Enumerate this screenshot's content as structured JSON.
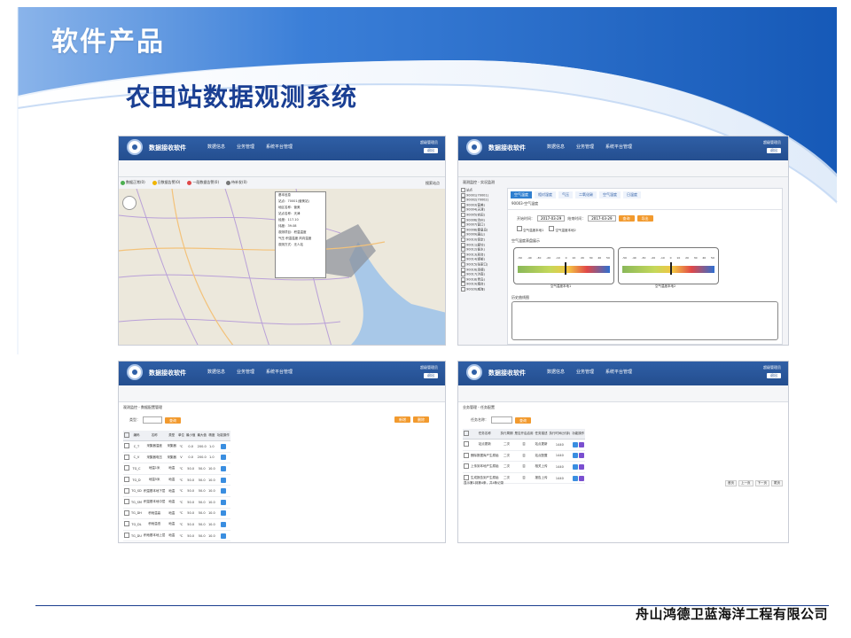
{
  "slide": {
    "title": "软件产品",
    "subtitle": "农田站数据观测系统",
    "company": "舟山鸿德卫蓝海洋工程有限公司",
    "colors": {
      "banner": "#1f5fb8",
      "accent": "#1a3f93",
      "button": "#f29a2e"
    }
  },
  "app": {
    "name": "数据接收软件",
    "nav": [
      "数据信息",
      "业务管理",
      "系统平台管理"
    ],
    "user": "超级管理员",
    "logout": "退出"
  },
  "map_view": {
    "legend": [
      "数据正常(0)",
      "日数据告警(0)",
      "一段数据告警(0)",
      "待补发(0)"
    ],
    "search": "搜索站点",
    "popup": [
      "基本信息",
      "站点：70001(营美站)",
      "地区名称：营美",
      "站点名称：天津",
      "经度：117.10",
      "纬度：39.08",
      "观测项目：积温温度",
      "气压 积温温度 风向温度",
      "观测方式：无人站"
    ]
  },
  "temp_view": {
    "breadcrumb": "观测监控 - 实况监测",
    "tree": [
      "站点",
      "90001(70001)",
      "90002(70002)",
      "90003(营美)",
      "90004(天津)",
      "90005(农田)",
      "90006(沧州)",
      "90007(营口)",
      "90008(秦皇岛)",
      "90009(唐山)",
      "90010(保定)",
      "90011(廊坊)",
      "90012(衡水)",
      "90013(邢台)",
      "90014(邯郸)",
      "90015(张家口)",
      "90016(承德)",
      "90017(济南)",
      "90018(青岛)",
      "90019(烟台)",
      "90020(威海)"
    ],
    "tabs": [
      "空气温度",
      "相对湿度",
      "气压",
      "二氧化碳",
      "空气湿度",
      "日温度"
    ],
    "station_label": "90003-空气温度",
    "start_label": "开始时间：",
    "start_value": "2017-03-29",
    "end_label": "结束时间：",
    "end_value": "2017-03-29",
    "query": "查询",
    "export": "导出",
    "check1": "空气温度本地1",
    "check2": "空气温度本地2",
    "chart_title": "空气温度表盘展示",
    "gauge_ticks": [
      "-50",
      "-40",
      "-30",
      "-20",
      "-10",
      "0",
      "10",
      "20",
      "30",
      "40",
      "50"
    ],
    "gauge1_label": "空气温度本地1",
    "gauge2_label": "空气温度本地2",
    "curve_title": "历史曲线图"
  },
  "param_view": {
    "breadcrumb": "观测监控 - 数据配置管理",
    "type_label": "类型：",
    "query": "查询",
    "add": "新增",
    "delete": "删除",
    "columns": [
      "",
      "编码",
      "名称",
      "类型",
      "单位",
      "最小值",
      "最大值",
      "精度",
      "功能操作"
    ],
    "rows": [
      [
        "C_T",
        "采集器温度",
        "采集器",
        "℃",
        "0.0",
        "200.0",
        "1.0"
      ],
      [
        "C_V",
        "采集器电压",
        "采集器",
        "V",
        "0.0",
        "200.0",
        "1.0"
      ],
      [
        "TG_C",
        "地温1米",
        "地温",
        "℃",
        "50.0",
        "50.0",
        "10.0"
      ],
      [
        "TG_D",
        "地温5米",
        "地温",
        "℃",
        "50.0",
        "50.0",
        "10.0"
      ],
      [
        "TG_SD",
        "积温基本地下层",
        "地温",
        "℃",
        "50.0",
        "50.0",
        "10.0"
      ],
      [
        "TG_SM",
        "积温基本地中层",
        "地温",
        "℃",
        "50.0",
        "50.0",
        "10.0"
      ],
      [
        "TG_DH",
        "积地温高",
        "地温",
        "℃",
        "50.0",
        "50.0",
        "10.0"
      ],
      [
        "TG_DL",
        "积地温低",
        "地温",
        "℃",
        "50.0",
        "50.0",
        "10.0"
      ],
      [
        "TG_DU",
        "积地基本地上层",
        "地温",
        "℃",
        "50.0",
        "50.0",
        "10.0"
      ],
      [
        "TG_M",
        "地温中层",
        "地温",
        "℃",
        "50.0",
        "50.0",
        "10.0"
      ],
      [
        "TG_N",
        "地温平层",
        "地温",
        "℃",
        "50.0",
        "50.0",
        "10.0"
      ]
    ]
  },
  "task_view": {
    "breadcrumb": "业务管理 - 任务配置",
    "name_label": "任务名称：",
    "query": "查询",
    "columns": [
      "",
      "任务名称",
      "执行周期",
      "是否开启启用",
      "任务描述",
      "执行时间(分钟)",
      "功能操作"
    ],
    "rows": [
      [
        "站点更新",
        "二次",
        "否",
        "站点更新",
        "1440"
      ],
      [
        "删除数据库产生原始",
        "二次",
        "否",
        "站点配置",
        "1440"
      ],
      [
        "上传到本地产生原始",
        "二次",
        "否",
        "相关上传",
        "1440"
      ],
      [
        "生成报告到产生原始",
        "二次",
        "否",
        "报告上传",
        "1440"
      ]
    ],
    "footer": "显示第1到第4条，共4条记录",
    "pager": [
      "首页",
      "上一页",
      "下一页",
      "尾页"
    ]
  }
}
